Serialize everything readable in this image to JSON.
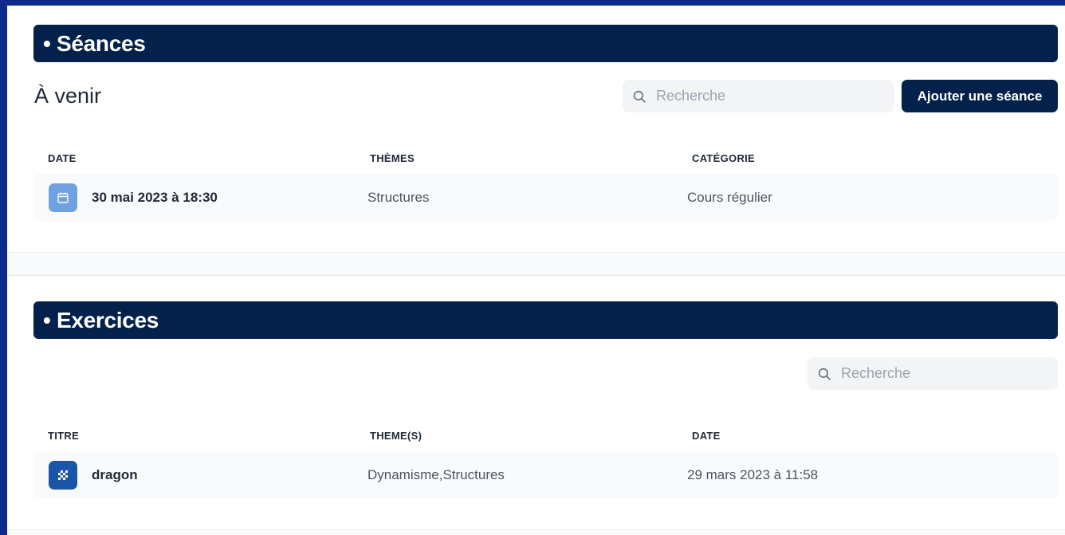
{
  "seances": {
    "header": "• Séances",
    "subtitle": "À venir",
    "search_placeholder": "Recherche",
    "add_button": "Ajouter une séance",
    "columns": [
      "DATE",
      "THÈMES",
      "CATÉGORIE"
    ],
    "rows": [
      {
        "date": "30 mai 2023 à 18:30",
        "themes": "Structures",
        "categorie": "Cours régulier",
        "icon": "calendar-icon"
      }
    ]
  },
  "exercices": {
    "header": "• Exercices",
    "search_placeholder": "Recherche",
    "columns": [
      "TITRE",
      "THEME(S)",
      "DATE"
    ],
    "rows": [
      {
        "titre": "dragon",
        "themes": "Dynamisme,Structures",
        "date": "29 mars 2023 à 11:58",
        "icon": "checkerboard-icon"
      }
    ]
  },
  "colors": {
    "page_background": "#0e2a8a",
    "header_navy": "#03214a",
    "calendar_icon_bg": "#6fa2e0",
    "exercise_icon_bg": "#1a56a8",
    "row_background": "#f9fafb",
    "search_background": "#f3f4f6"
  }
}
